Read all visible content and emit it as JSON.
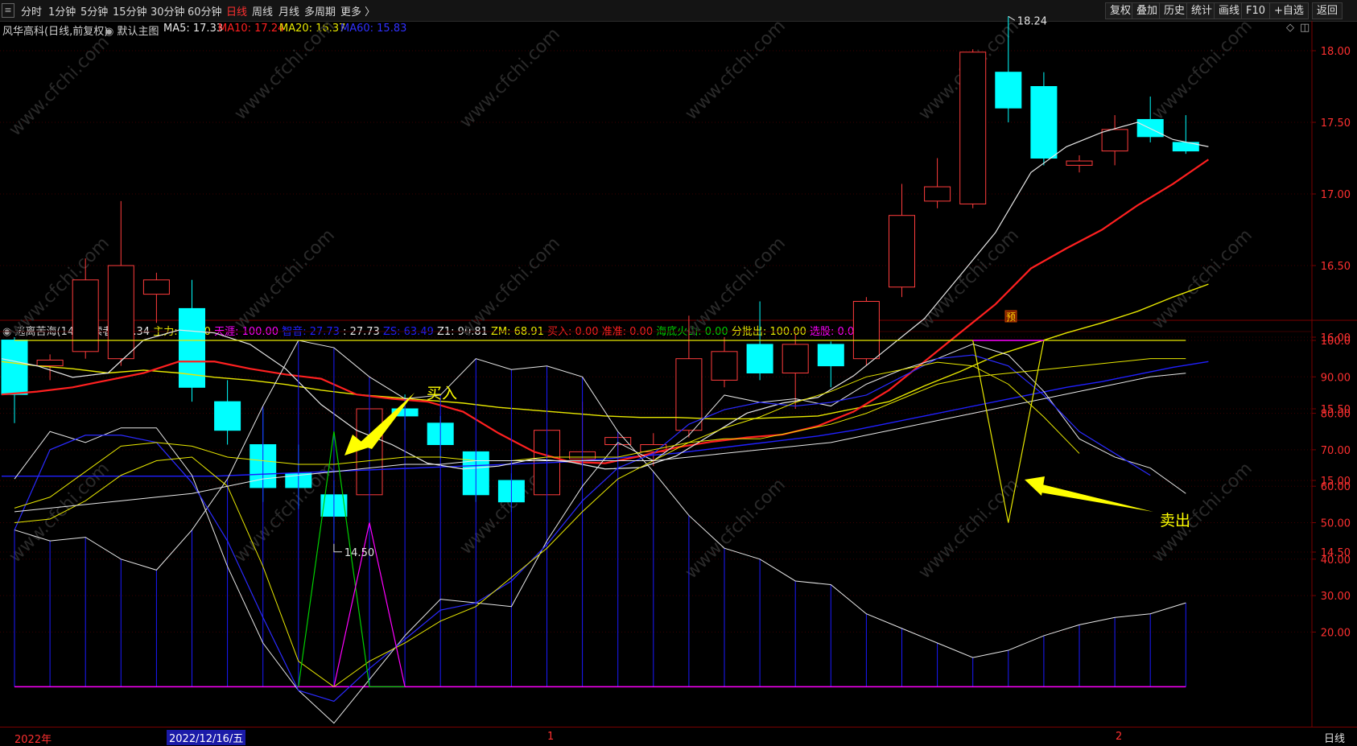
{
  "toolbar": {
    "periods": [
      "分时",
      "1分钟",
      "5分钟",
      "15分钟",
      "30分钟",
      "60分钟",
      "日线",
      "周线",
      "月线",
      "多周期",
      "更多 〉"
    ],
    "active_period": "日线",
    "right_buttons": [
      "复权",
      "叠加",
      "历史",
      "统计",
      "画线",
      "F10",
      "+自选",
      "返回"
    ]
  },
  "main_header": {
    "stock": "风华高科(日线,前复权)",
    "mode": "默认主图",
    "ma5": "MA5: 17.33",
    "ma10": "MA10: 17.24",
    "ma20": "MA20: 16.37",
    "ma60": "MA60: 15.83"
  },
  "colors": {
    "up": "#ff3c3c",
    "down": "#00ffff",
    "ma5": "#e8e8e8",
    "ma10": "#ff2020",
    "ma20": "#e8e800",
    "ma60": "#2020ff",
    "axis": "#7a0000",
    "green": "#00d000",
    "magenta": "#ff00ff"
  },
  "price_axis": {
    "ticks": [
      "18.00",
      "17.50",
      "17.00",
      "16.50",
      "16.00",
      "15.50",
      "15.00",
      "14.50"
    ]
  },
  "price_marks": {
    "high": "18.24",
    "low": "14.50",
    "yu": "预"
  },
  "candles": [
    [
      15.98,
      15.6,
      16.0,
      15.4
    ],
    [
      15.8,
      15.84,
      15.88,
      15.7
    ],
    [
      15.9,
      16.4,
      16.55,
      15.85
    ],
    [
      15.85,
      16.5,
      16.95,
      15.8
    ],
    [
      16.3,
      16.4,
      16.45,
      16.1
    ],
    [
      16.2,
      15.65,
      16.4,
      15.55
    ],
    [
      15.55,
      15.35,
      15.7,
      15.25
    ],
    [
      15.25,
      14.95,
      15.5,
      14.85
    ],
    [
      15.05,
      14.95,
      15.25,
      14.8
    ],
    [
      14.9,
      14.75,
      15.0,
      14.58
    ],
    [
      14.9,
      15.5,
      15.6,
      14.85
    ],
    [
      15.5,
      15.45,
      15.6,
      15.35
    ],
    [
      15.4,
      15.25,
      15.45,
      15.15
    ],
    [
      15.2,
      14.9,
      15.2,
      14.85
    ],
    [
      15.0,
      14.85,
      15.05,
      14.78
    ],
    [
      14.9,
      15.35,
      15.37,
      14.7
    ],
    [
      15.15,
      15.2,
      15.55,
      15.1
    ],
    [
      15.25,
      15.3,
      15.33,
      15.15
    ],
    [
      15.2,
      15.25,
      15.33,
      15.1
    ],
    [
      15.35,
      15.85,
      16.15,
      15.3
    ],
    [
      15.7,
      15.9,
      16.0,
      15.65
    ],
    [
      15.95,
      15.75,
      16.25,
      15.7
    ],
    [
      15.75,
      15.95,
      16.02,
      15.5
    ],
    [
      15.95,
      15.8,
      15.97,
      15.65
    ],
    [
      15.85,
      16.25,
      16.28,
      15.8
    ],
    [
      16.35,
      16.85,
      17.07,
      16.28
    ],
    [
      16.95,
      17.05,
      17.25,
      16.9
    ],
    [
      16.93,
      17.99,
      18.01,
      16.9
    ],
    [
      17.85,
      17.6,
      18.24,
      17.5
    ],
    [
      17.75,
      17.25,
      17.85,
      17.2
    ],
    [
      17.2,
      17.23,
      17.27,
      17.15
    ],
    [
      17.3,
      17.45,
      17.55,
      17.2
    ],
    [
      17.52,
      17.4,
      17.68,
      17.36
    ],
    [
      17.36,
      17.3,
      17.55,
      17.28
    ]
  ],
  "ma_lines": {
    "ma5": [
      15.85,
      15.8,
      15.72,
      15.75,
      15.98,
      16.05,
      16.03,
      15.95,
      15.78,
      15.53,
      15.35,
      15.25,
      15.12,
      15.08,
      15.1,
      15.15,
      15.13,
      15.08,
      15.09,
      15.17,
      15.32,
      15.47,
      15.54,
      15.58,
      15.73,
      15.93,
      16.13,
      16.43,
      16.73,
      17.15,
      17.33,
      17.43,
      17.5,
      17.38,
      17.33
    ],
    "ma10": [
      15.6,
      15.62,
      15.65,
      15.7,
      15.75,
      15.83,
      15.83,
      15.78,
      15.74,
      15.71,
      15.6,
      15.57,
      15.55,
      15.48,
      15.33,
      15.2,
      15.13,
      15.12,
      15.17,
      15.23,
      15.27,
      15.3,
      15.32,
      15.38,
      15.48,
      15.63,
      15.83,
      16.03,
      16.23,
      16.48,
      16.62,
      16.75,
      16.92,
      17.07,
      17.24
    ],
    "ma20": [
      15.83,
      15.8,
      15.78,
      15.75,
      15.77,
      15.75,
      15.72,
      15.7,
      15.67,
      15.63,
      15.6,
      15.58,
      15.56,
      15.54,
      15.51,
      15.49,
      15.47,
      15.45,
      15.44,
      15.44,
      15.43,
      15.43,
      15.44,
      15.45,
      15.5,
      15.55,
      15.66,
      15.76,
      15.87,
      15.95,
      16.03,
      16.1,
      16.18,
      16.28,
      16.37
    ],
    "ma60": [
      15.03,
      15.03,
      15.03,
      15.03,
      15.03,
      15.03,
      15.03,
      15.04,
      15.05,
      15.06,
      15.07,
      15.08,
      15.09,
      15.1,
      15.11,
      15.12,
      15.13,
      15.15,
      15.17,
      15.19,
      15.22,
      15.25,
      15.28,
      15.31,
      15.35,
      15.4,
      15.45,
      15.5,
      15.55,
      15.6,
      15.65,
      15.69,
      15.74,
      15.79,
      15.83
    ]
  },
  "indicator_header": {
    "name": "逃离苦海(14)",
    "explorer": "探索者: 57.34",
    "zhuli": "主力: 94.80",
    "tianti": "天涯: 100.00",
    "zhiyin": "智音: 27.73",
    "blank": ": 27.73",
    "zs": "ZS: 63.49",
    "z1": "Z1: 90.81",
    "zm": "ZM: 68.91",
    "buy": "买入: 0.00",
    "quasi": "准准: 0.00",
    "volcano": "海底火山: 0.00",
    "batch_out": "分批出: 100.00",
    "pick": "选股: 0.00"
  },
  "indicator_axis": {
    "ticks": [
      "100.0",
      "90.00",
      "80.00",
      "70.00",
      "60.00",
      "50.00",
      "40.00",
      "30.00",
      "20.00"
    ]
  },
  "indicator_lines": {
    "explorer": [
      48,
      45,
      46,
      40,
      37,
      48,
      62,
      82,
      100,
      98,
      90,
      84,
      85,
      95,
      92,
      93,
      90,
      75,
      64,
      52,
      43,
      40,
      34,
      33,
      25,
      21,
      17,
      13,
      15,
      19,
      22,
      24,
      25,
      28
    ],
    "white_top": [
      62,
      75,
      72,
      76,
      76,
      63,
      38,
      17,
      4,
      -5,
      7,
      19,
      29,
      28,
      27,
      45,
      60,
      72,
      67,
      74,
      85,
      83,
      84,
      82,
      88,
      92,
      95,
      99,
      96,
      86,
      73,
      68,
      65,
      58
    ],
    "blue": [
      48,
      70,
      74,
      74,
      72,
      61,
      45,
      24,
      4,
      1,
      10,
      18,
      26,
      28,
      34,
      44,
      56,
      65,
      69,
      77,
      81,
      83,
      82,
      83,
      85,
      90,
      95,
      96,
      93,
      85,
      75,
      69,
      63
    ],
    "yellow_mid": [
      50,
      51,
      56,
      63,
      67,
      68,
      60,
      38,
      12,
      5,
      12,
      17,
      23,
      27,
      35,
      43,
      53,
      62,
      67,
      72,
      76,
      79,
      83,
      86,
      90,
      92,
      94,
      93,
      88,
      79,
      69
    ],
    "yellow_flat": [
      54,
      57,
      64,
      71,
      72,
      71,
      68,
      67,
      66,
      66,
      67,
      68,
      68,
      67,
      67,
      68,
      68,
      68,
      70,
      72,
      73,
      73,
      75,
      77,
      80,
      84,
      88,
      90,
      91,
      92,
      93,
      94,
      95,
      95
    ],
    "white_slow": [
      53,
      54,
      55,
      56,
      57,
      58,
      60,
      62,
      63,
      64,
      65,
      66,
      66,
      67,
      67,
      67,
      67,
      67,
      67,
      68,
      69,
      70,
      71,
      72,
      74,
      76,
      78,
      80,
      82,
      84,
      86,
      88,
      90,
      91
    ],
    "yellow_top": [
      100,
      100,
      100,
      100,
      100,
      100,
      100,
      100,
      100,
      100,
      100,
      100,
      100,
      100,
      100,
      100,
      100,
      100,
      100,
      100,
      100,
      100,
      100,
      100,
      100,
      100,
      100,
      100,
      50,
      100,
      100,
      100,
      100,
      100
    ]
  },
  "signals": {
    "buy_label": "买入",
    "sell_label": "卖出"
  },
  "date_axis": {
    "year": "2022年",
    "cursor_date": "2022/12/16/五",
    "m1": "1",
    "m2": "2"
  },
  "bottom_right_label": "日线",
  "watermark": "www.cfchi.com"
}
